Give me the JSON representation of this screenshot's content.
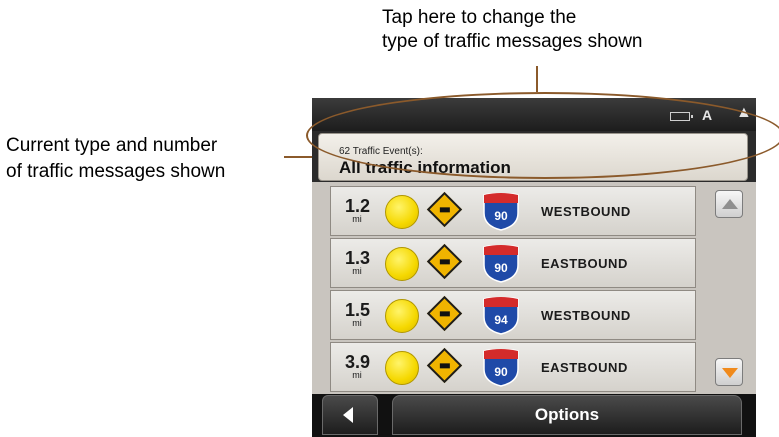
{
  "callouts": {
    "top_line1": "Tap here to change the",
    "top_line2": "type of traffic messages shown",
    "left_line1": "Current type and number",
    "left_line2": "of traffic messages shown"
  },
  "topbar": {
    "icons": [
      "battery-icon",
      "letter-a-icon",
      "signal-icon"
    ],
    "letter": "A",
    "signal": "▲"
  },
  "header": {
    "event_count": "62 Traffic Event(s):",
    "event_type": "All traffic information"
  },
  "rows": [
    {
      "distance": "1.2",
      "unit": "mi",
      "route": "90",
      "direction": "WESTBOUND"
    },
    {
      "distance": "1.3",
      "unit": "mi",
      "route": "90",
      "direction": "EASTBOUND"
    },
    {
      "distance": "1.5",
      "unit": "mi",
      "route": "94",
      "direction": "WESTBOUND"
    },
    {
      "distance": "3.9",
      "unit": "mi",
      "route": "90",
      "direction": "EASTBOUND"
    }
  ],
  "bottom": {
    "options_label": "Options"
  },
  "colors": {
    "accent_callout": "#8b5a2b",
    "shield_red": "#d42b2b",
    "shield_blue": "#1f4aa8",
    "dot_yellow": "#f5d800",
    "scroll_down_arrow": "#f08a1c"
  }
}
